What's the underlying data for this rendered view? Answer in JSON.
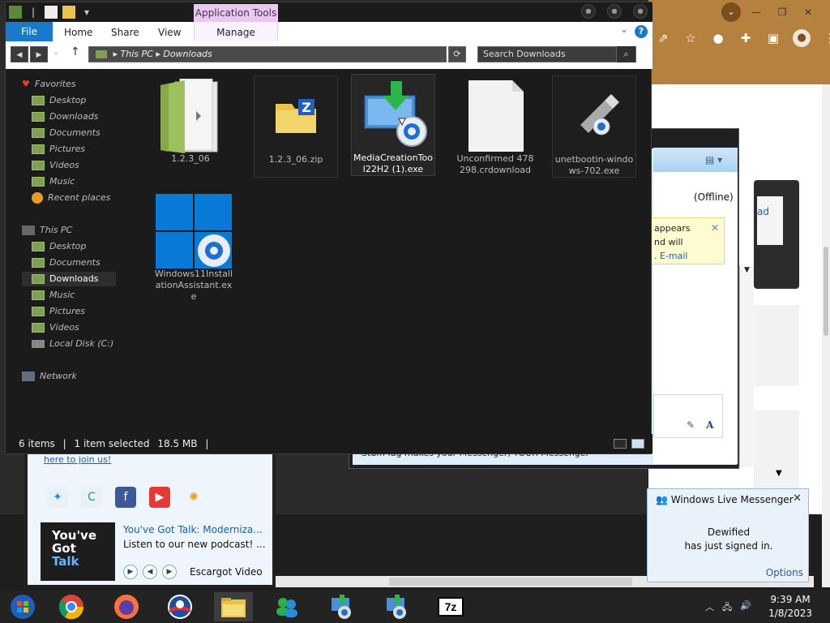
{
  "explorer": {
    "context_tab": "Application Tools",
    "ribbon_tabs": [
      {
        "label": "File"
      },
      {
        "label": "Home"
      },
      {
        "label": "Share"
      },
      {
        "label": "View"
      },
      {
        "label": "Manage"
      }
    ],
    "address": {
      "parts": [
        "This PC",
        "Downloads"
      ]
    },
    "search_placeholder": "Search Downloads",
    "nav": {
      "favorites_label": "Favorites",
      "favorites": [
        "Desktop",
        "Downloads",
        "Documents",
        "Pictures",
        "Videos",
        "Music",
        "Recent places"
      ],
      "this_pc_label": "This PC",
      "this_pc": [
        "Desktop",
        "Documents",
        "Downloads",
        "Music",
        "Pictures",
        "Videos",
        "Local Disk (C:)"
      ],
      "network_label": "Network",
      "selected": "Downloads"
    },
    "files": [
      {
        "name": "1.2.3_06",
        "icon": "folder-icon"
      },
      {
        "name": "1.2.3_06.zip",
        "icon": "zip-folder-icon"
      },
      {
        "name": "MediaCreationTool22H2 (1).exe",
        "icon": "media-creation-tool-icon"
      },
      {
        "name": "Unconfirmed 478298.crdownload",
        "icon": "blank-file-icon"
      },
      {
        "name": "unetbootin-windows-702.exe",
        "icon": "usb-installer-icon"
      },
      {
        "name": "Windows11InstallationAssistant.exe",
        "icon": "windows-logo-icon"
      }
    ],
    "status": {
      "items": "6 items",
      "selected": "1 item selected",
      "size": "18.5 MB"
    }
  },
  "messenger_chat": {
    "offline": "(Offline)",
    "alert_lines": [
      "appears",
      "nd will",
      ". E-mail"
    ],
    "strip_text": "StuffPlug makes your Messenger, YOUR Messenger"
  },
  "messenger_main": {
    "join_text": "here to join us!",
    "news_title": "You've Got Talk: Moderniza...",
    "news_desc": "Listen to our new podcast! ...",
    "thumb_line1": "You've",
    "thumb_line2": "Got",
    "thumb_line3": "Talk",
    "player_label": "Escargot Video"
  },
  "browser": {
    "panel_text": "ad"
  },
  "toast": {
    "title": "Windows Live Messenger",
    "name": "Dewified",
    "message": "has just signed in.",
    "options": "Options"
  },
  "taskbar": {
    "items": [
      "Start",
      "Chrome",
      "Firefox",
      "Obama",
      "File Explorer",
      "Messenger",
      "Setup 1",
      "Setup 2",
      "7z"
    ],
    "icon_7z": "7z",
    "time": "9:39 AM",
    "date": "1/8/2023"
  },
  "left_strip": {
    "chars": "M\nt"
  }
}
